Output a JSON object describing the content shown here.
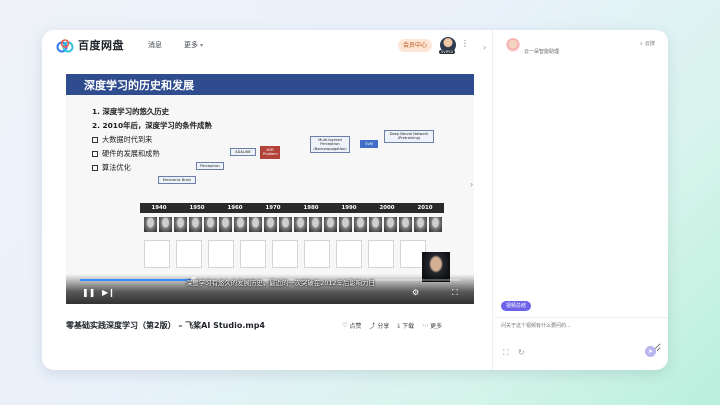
{
  "app": {
    "name": "百度网盘"
  },
  "nav": {
    "items": [
      "消息",
      "更多"
    ]
  },
  "header": {
    "member_label": "会员中心",
    "avatar_badge": "SVIP10",
    "menu": "⋮"
  },
  "video": {
    "title": "零基础实践深度学习（第2版） – 飞桨AI Studio.mp4",
    "subtitle": "深度学习有悠久的发展历史，最近的一次突破在2012年后影响力日",
    "progress_fraction": 0.3,
    "actions": [
      {
        "icon": "heart-icon",
        "label": "点赞"
      },
      {
        "icon": "share-icon",
        "label": "分享"
      },
      {
        "icon": "download-icon",
        "label": "下载"
      },
      {
        "icon": "more-icon",
        "label": "更多"
      }
    ]
  },
  "slide": {
    "title": "深度学习的历史和发展",
    "points": [
      "1. 深度学习的悠久历史",
      "2. 2010年后，深度学习的条件成熟"
    ],
    "bullets": [
      "大数据时代到来",
      "硬件的发展和成熟",
      "算法优化"
    ],
    "timeline_labels": [
      "Electronic Brain",
      "Perceptron",
      "ADALINE",
      "XOR Problem",
      "Multi-layered Perceptron (Backpropagation)",
      "SVM",
      "Deep Neural Network (Pretraining)"
    ],
    "years": [
      "1940",
      "1950",
      "1960",
      "1970",
      "1980",
      "1990",
      "2000",
      "2010"
    ]
  },
  "sidebar": {
    "assistant_name": "云一朵智能助理",
    "top_action": "云搜",
    "summary_button": "视频总结",
    "input_placeholder": "问关于这个视频有什么要问的…"
  },
  "colors": {
    "accent": "#6d63e8",
    "slide_header": "#2f4c8e",
    "progress": "#3a8bff"
  }
}
